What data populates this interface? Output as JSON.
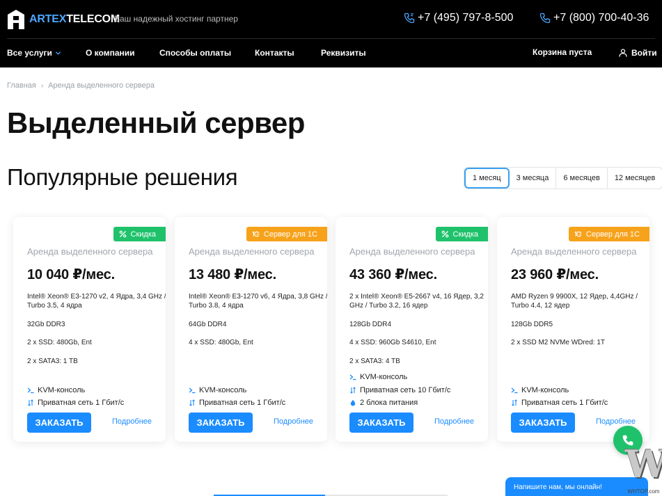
{
  "header": {
    "logo_bold": "ARTEX",
    "logo_light": "TELECOM",
    "tagline": "Ваш надежный хостинг партнер",
    "phone1": "+7 (495) 797-8-500",
    "phone2": "+7 (800) 700-40-36",
    "nav": [
      "Все услуги",
      "О компании",
      "Способы оплаты",
      "Контакты",
      "Реквизиты"
    ],
    "cart": "Корзина пуста",
    "login": "Войти"
  },
  "breadcrumb": {
    "home": "Главная",
    "current": "Аренда выделенного сервера"
  },
  "page_title": "Выделенный сервер",
  "section_title": "Популярные решения",
  "periods": [
    "1 месяц",
    "3 месяца",
    "6 месяцев",
    "12 месяцев"
  ],
  "active_period": "1 месяц",
  "cards": [
    {
      "badge": "Скидка",
      "badge_color": "#1fc26b",
      "badge_icon": "percent-icon",
      "subtitle": "Аренда выделенного сервера",
      "price": "10 040 ₽/мес.",
      "cpu": "Intel® Xeon® E3-1270 v2, 4 Ядра, 3,4 GHz / Turbo 3.5, 4 ядра",
      "ram": "32Gb DDR3",
      "disk1": "2 x SSD: 480Gb, Ent",
      "disk2": "2 x SATA3: 1 TB",
      "features": [
        "KVM-консоль",
        "Приватная сеть 1 Гбит/с"
      ],
      "order": "ЗАКАЗАТЬ",
      "more": "Подробнее"
    },
    {
      "badge": "Сервер для 1С",
      "badge_color": "#f7a21b",
      "badge_icon": "1c-icon",
      "subtitle": "Аренда выделенного сервера",
      "price": "13 480 ₽/мес.",
      "cpu": "Intel® Xeon® E3-1270 v6, 4 Ядра, 3,8 GHz / Turbo 3.8, 4 ядра",
      "ram": "64Gb DDR4",
      "disk1": "4 x SSD: 480Gb, Ent",
      "disk2": "",
      "features": [
        "KVM-консоль",
        "Приватная сеть 1 Гбит/с"
      ],
      "order": "ЗАКАЗАТЬ",
      "more": "Подробнее"
    },
    {
      "badge": "Скидка",
      "badge_color": "#1fc26b",
      "badge_icon": "percent-icon",
      "subtitle": "Аренда выделенного сервера",
      "price": "43 360 ₽/мес.",
      "cpu": "2 x Intel® Xeon® E5-2667 v4, 16 Ядер, 3,2 GHz / Turbo 3.2, 16 ядер",
      "ram": "128Gb DDR4",
      "disk1": "4 x SSD: 960Gb S4610, Ent",
      "disk2": "2 x SATA3: 4 TB",
      "features": [
        "KVM-консоль",
        "Приватная сеть 10 Гбит/с",
        "2 блока питания"
      ],
      "order": "ЗАКАЗАТЬ",
      "more": "Подробнее"
    },
    {
      "badge": "Сервер для 1С",
      "badge_color": "#f7a21b",
      "badge_icon": "1c-icon",
      "subtitle": "Аренда выделенного сервера",
      "price": "23 960 ₽/мес.",
      "cpu": "AMD Ryzen 9 9900X, 12 Ядер, 4,4GHz / Turbo 4.4, 12 ядер",
      "ram": "128Gb DDR5",
      "disk1": "2 x SSD M2 NVMe WDred: 1T",
      "disk2": "",
      "features": [
        "KVM-консоль",
        "Приватная сеть 1 Гбит/с"
      ],
      "order": "ЗАКАЗАТЬ",
      "more": "Подробнее"
    }
  ],
  "chat_label": "Напишите нам, мы онлайн!",
  "watermark": {
    "letters": "W",
    "site": "WHTOP.com"
  },
  "colors": {
    "accent": "#1a8cff",
    "green": "#1fc26b",
    "orange": "#f7a21b",
    "header_bg": "#000000"
  }
}
